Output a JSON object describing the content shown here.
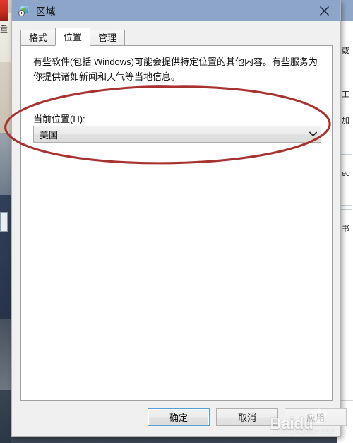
{
  "window": {
    "title": "区域",
    "icon": "region-globe-clock-icon",
    "close_label": "✕",
    "titlebar_color": "#8ca5c8"
  },
  "tabs": [
    {
      "label": "格式",
      "selected": false
    },
    {
      "label": "位置",
      "selected": true
    },
    {
      "label": "管理",
      "selected": false
    }
  ],
  "panel": {
    "description": "有些软件(包括 Windows)可能会提供特定位置的其他内容。有些服务为你提供诸如新闻和天气等当地信息。",
    "field_label": "当前位置(H):",
    "combo": {
      "value": "美国",
      "arrow_icon": "chevron-down-icon"
    }
  },
  "footer": {
    "ok_label": "确定",
    "cancel_label": "取消",
    "apply_label": "应用"
  },
  "annotation": {
    "shape": "hand-drawn-ellipse",
    "color": "#a8322f"
  },
  "watermark": {
    "brand": "Baidu",
    "subtitle": "JINGYAN.BAIDU.COM",
    "overlay_text": "经验"
  },
  "background": {
    "right_window_fragments": [
      "或",
      "工",
      "加",
      "ec",
      "书"
    ]
  }
}
